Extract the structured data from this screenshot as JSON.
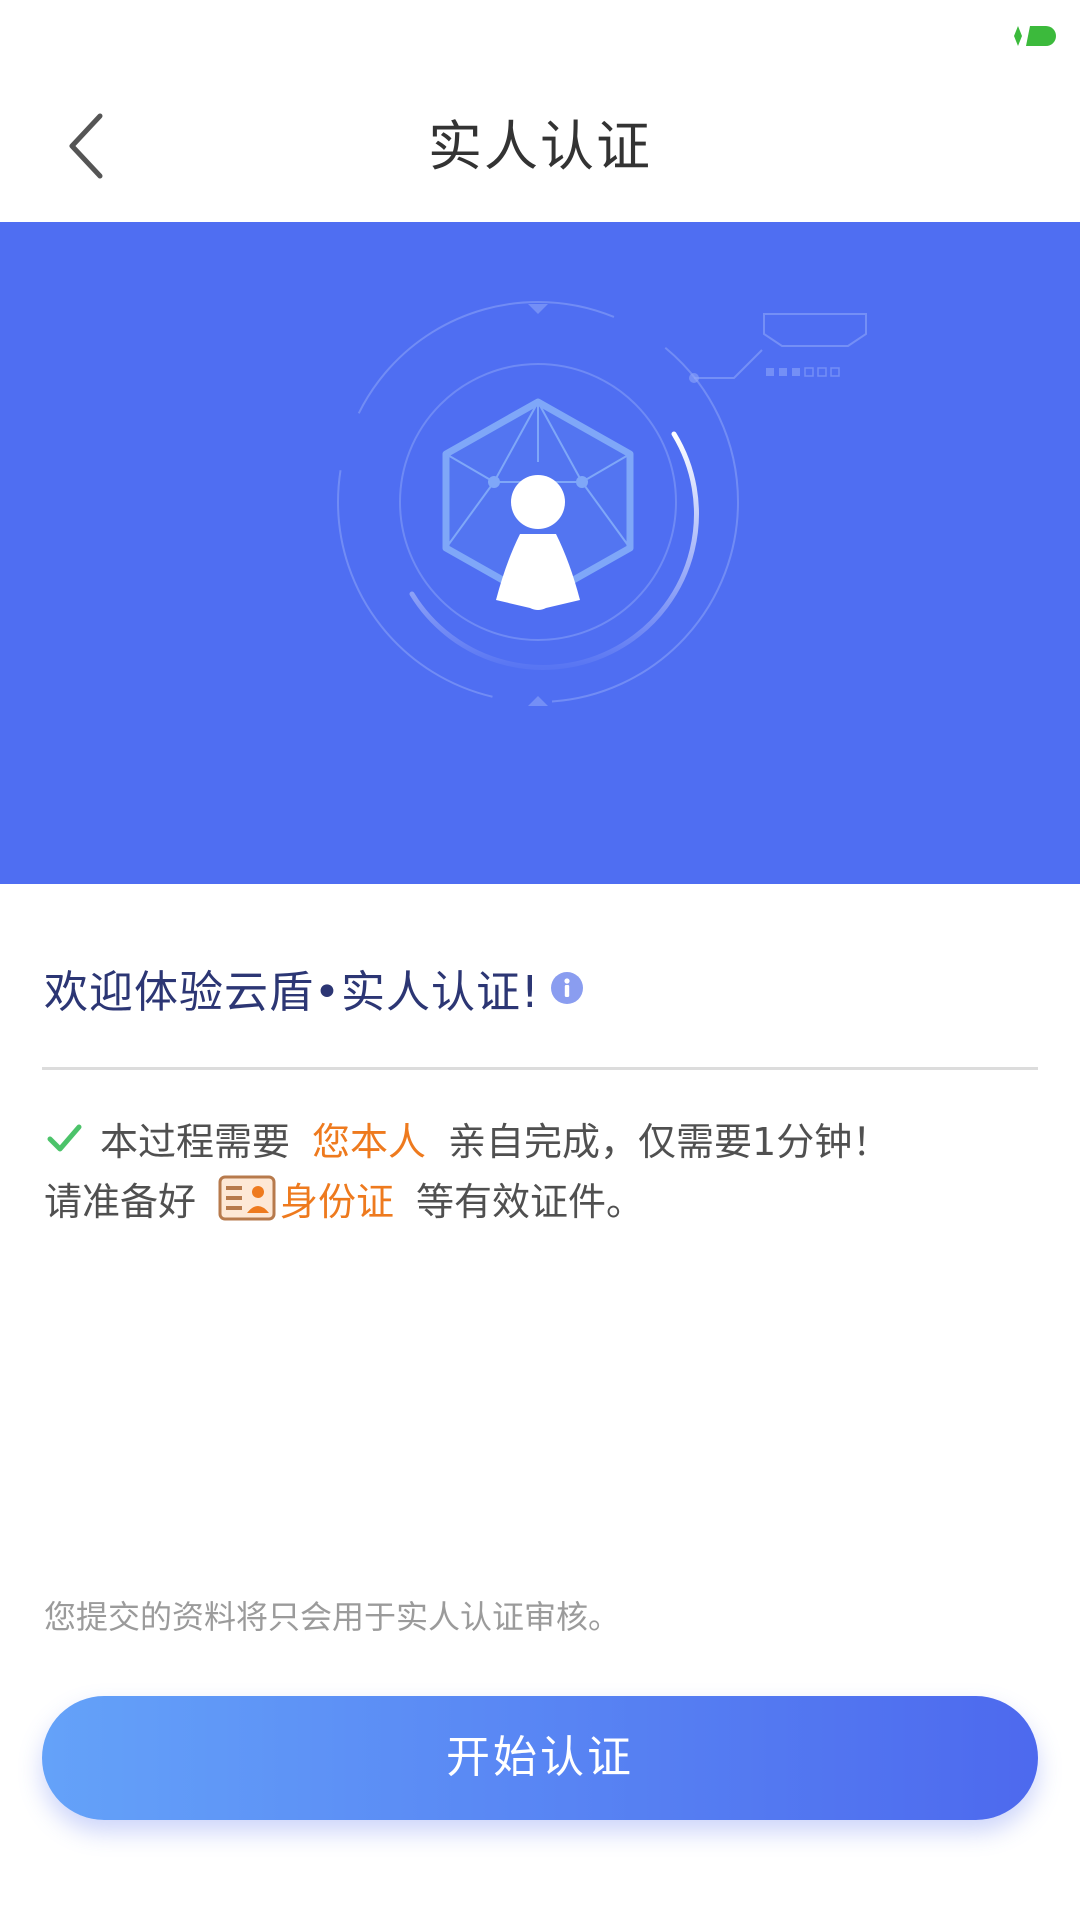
{
  "nav": {
    "title": "实人认证"
  },
  "welcome": {
    "text": "欢迎体验云盾•实人认证!"
  },
  "requirements": {
    "line1_prefix": "本过程需要",
    "line1_highlight": "您本人",
    "line1_suffix": "亲自完成，仅需要1分钟！",
    "line2_prefix": "请准备好",
    "line2_highlight": "身份证",
    "line2_suffix": "等有效证件。"
  },
  "disclaimer": "您提交的资料将只会用于实人认证审核。",
  "start_button_label": "开始认证",
  "icons": {
    "back": "chevron-left-icon",
    "info": "info-icon",
    "check": "check-icon",
    "id_card": "id-card-icon",
    "battery": "battery-icon",
    "hero": "face-verification-illustration"
  },
  "colors": {
    "hero_background": "#4f6ef2",
    "accent_orange": "#ee7a1e",
    "check_green": "#4cc36a",
    "title_text": "#333333",
    "welcome_text": "#2c3674",
    "button_gradient_start": "#64a2f9",
    "button_gradient_end": "#4d69ee"
  }
}
